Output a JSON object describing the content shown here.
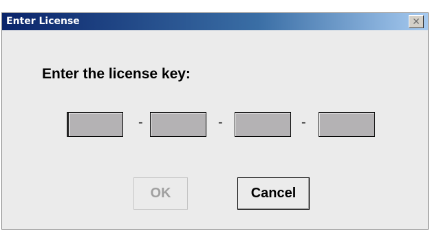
{
  "window": {
    "title": "Enter License"
  },
  "prompt": "Enter the license key:",
  "license_fields": [
    {
      "value": ""
    },
    {
      "value": ""
    },
    {
      "value": ""
    },
    {
      "value": ""
    }
  ],
  "separator": "-",
  "buttons": {
    "ok_label": "OK",
    "ok_enabled": false,
    "cancel_label": "Cancel"
  },
  "icons": {
    "close": "close-icon"
  },
  "colors": {
    "title_gradient_start": "#0a246a",
    "title_gradient_end": "#a6caf0",
    "dialog_background": "#ebebeb",
    "field_fill": "#b4b2b4",
    "disabled_text": "#a0a0a0"
  }
}
